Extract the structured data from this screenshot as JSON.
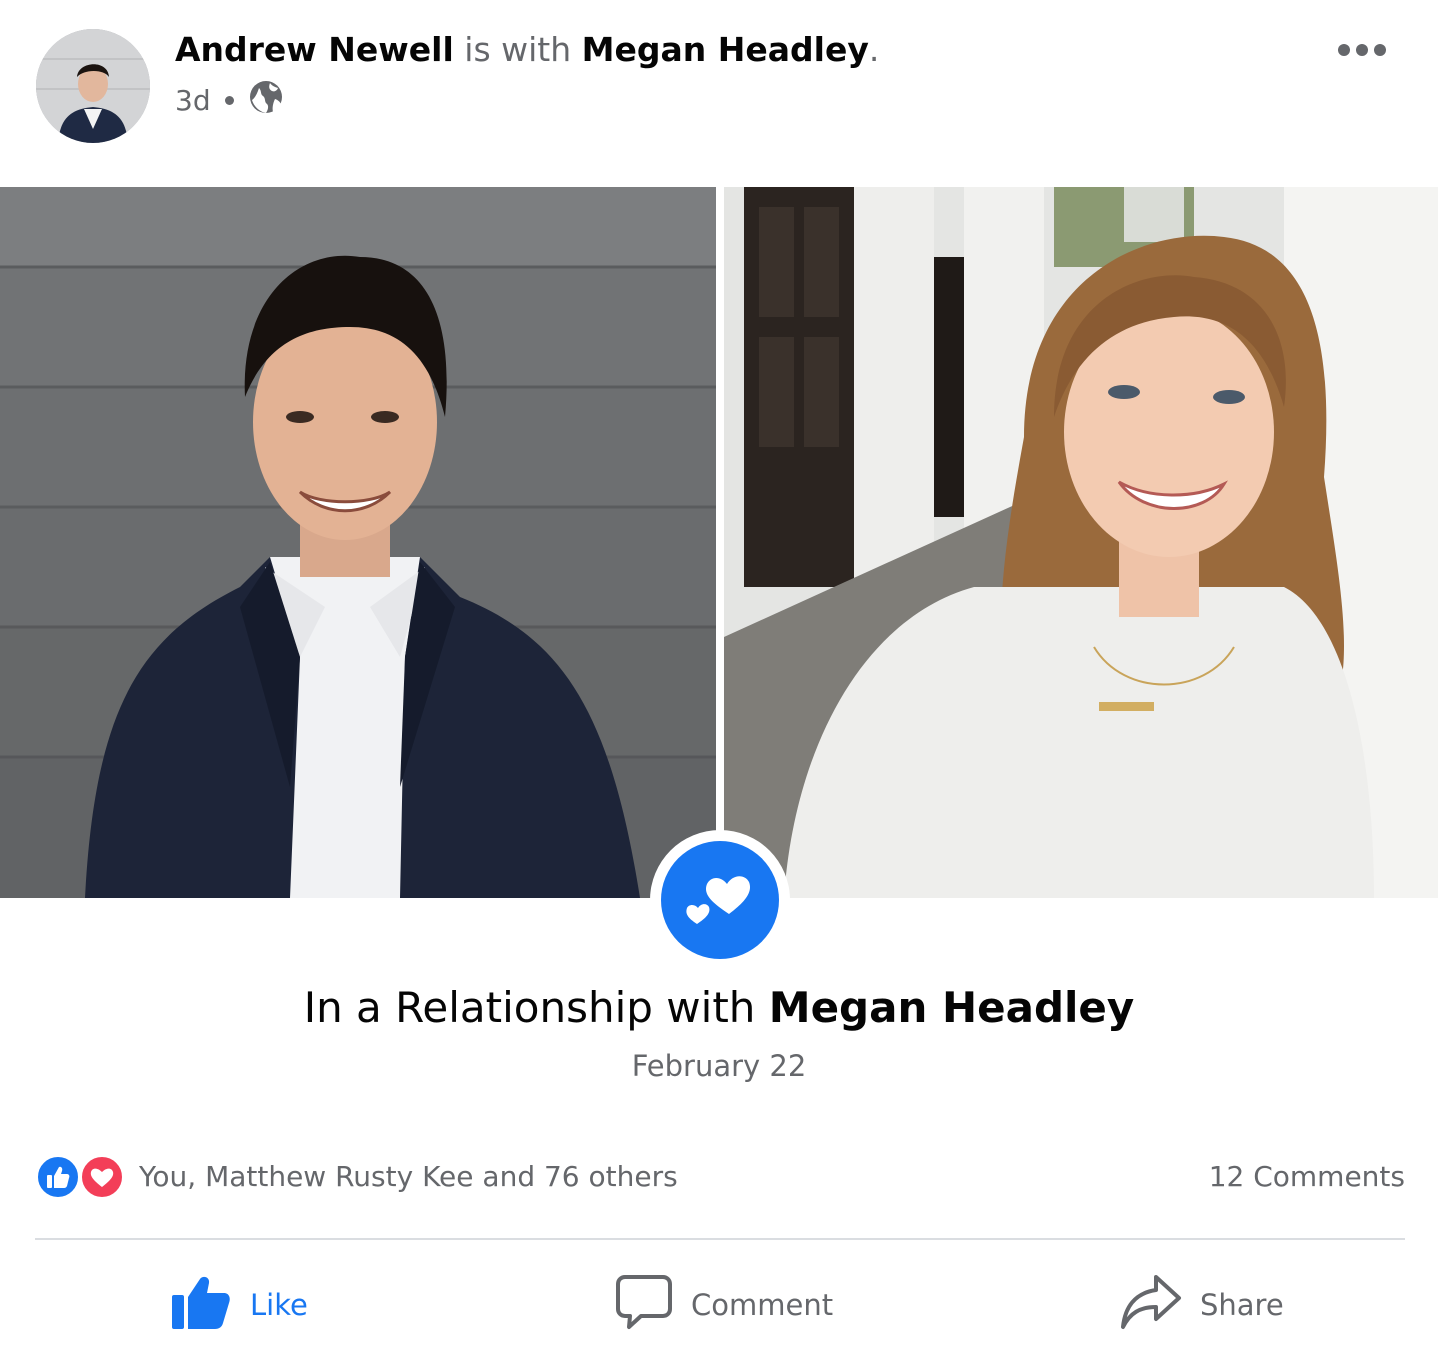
{
  "post": {
    "author": "Andrew Newell",
    "connector": "is with",
    "tagged": "Megan Headley",
    "end_punct": ".",
    "time": "3d",
    "audience_icon": "globe-icon",
    "more_icon": "more-options-icon"
  },
  "life_event": {
    "prefix": "In a Relationship with",
    "partner": "Megan Headley",
    "date": "February 22",
    "icon": "hearts-icon"
  },
  "engagement": {
    "reaction_icons": [
      "like-reaction-icon",
      "love-reaction-icon"
    ],
    "reaction_summary": "You, Matthew Rusty Kee and 76 others",
    "comments": "12 Comments"
  },
  "actions": {
    "like": "Like",
    "comment": "Comment",
    "share": "Share"
  },
  "colors": {
    "accent": "#1877f2",
    "love": "#f33e58",
    "muted_text": "#65676b"
  }
}
